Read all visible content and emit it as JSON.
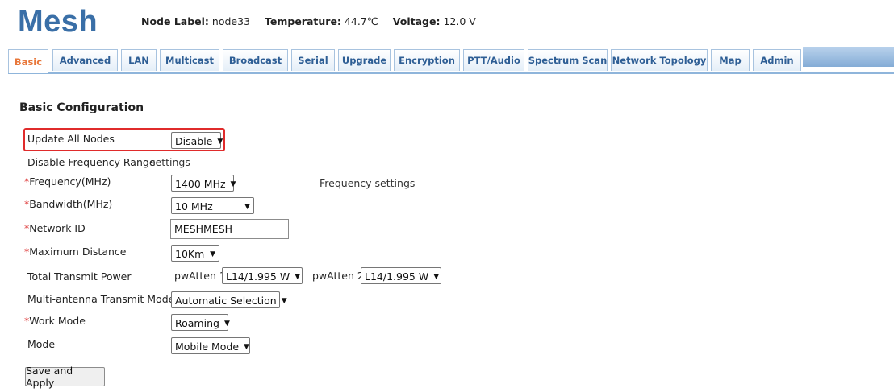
{
  "header": {
    "logo": "Mesh",
    "node_label_key": "Node Label:",
    "node_label_value": "node33",
    "temperature_key": "Temperature:",
    "temperature_value": "44.7℃",
    "voltage_key": "Voltage:",
    "voltage_value": "12.0 V"
  },
  "tabs": [
    {
      "label": "Basic",
      "active": true
    },
    {
      "label": "Advanced"
    },
    {
      "label": "LAN"
    },
    {
      "label": "Multicast"
    },
    {
      "label": "Broadcast"
    },
    {
      "label": "Serial"
    },
    {
      "label": "Upgrade"
    },
    {
      "label": "Encryption"
    },
    {
      "label": "PTT/Audio"
    },
    {
      "label": "Spectrum Scan"
    },
    {
      "label": "Network Topology"
    },
    {
      "label": "Map"
    },
    {
      "label": "Admin"
    }
  ],
  "section_title": "Basic Configuration",
  "fields": {
    "update_all_nodes": {
      "label": "Update All Nodes",
      "value": "Disable"
    },
    "disable_freq_range": {
      "label": "Disable Frequency Range",
      "link": "settings"
    },
    "frequency": {
      "required": "*",
      "label": "Frequency(MHz)",
      "value": "1400 MHz",
      "link": "Frequency settings"
    },
    "bandwidth": {
      "required": "*",
      "label": "Bandwidth(MHz)",
      "value": "10 MHz"
    },
    "network_id": {
      "required": "*",
      "label": "Network ID",
      "value": "MESHMESH"
    },
    "max_distance": {
      "required": "*",
      "label": "Maximum Distance",
      "value": "10Km"
    },
    "tx_power": {
      "label": "Total Transmit Power",
      "atten1_label": "pwAtten 1",
      "atten1_value": "L14/1.995 W",
      "atten2_label": "pwAtten 2",
      "atten2_value": "L14/1.995 W"
    },
    "multi_antenna": {
      "label": "Multi-antenna Transmit Mode",
      "value": "Automatic Selection"
    },
    "work_mode": {
      "required": "*",
      "label": "Work Mode",
      "value": "Roaming"
    },
    "mode": {
      "label": "Mode",
      "value": "Mobile Mode"
    }
  },
  "save_button": "Save and Apply",
  "colors": {
    "logo": "#3a6fa7",
    "active_tab": "#e8773a",
    "tab_text": "#2e5e95",
    "highlight": "#e02b2b",
    "required": "#dd3333"
  }
}
